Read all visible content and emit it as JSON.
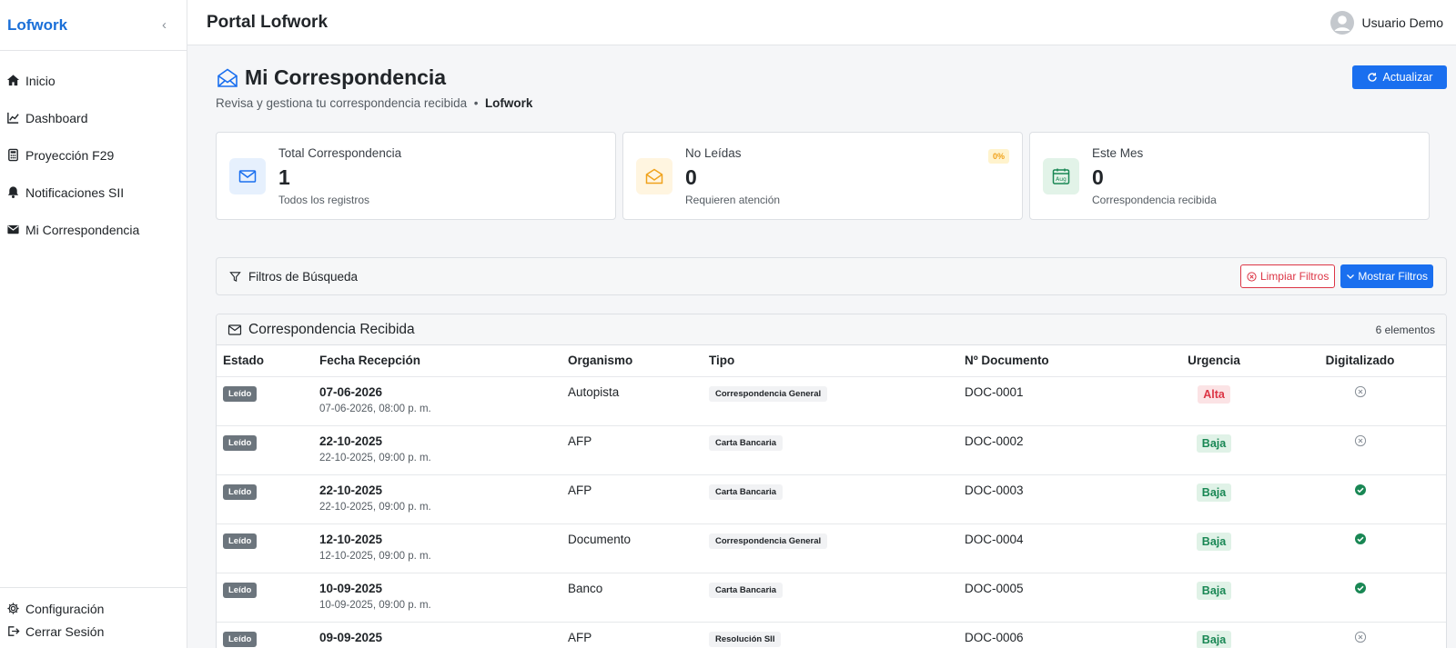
{
  "sidebar": {
    "brand": "Lofwork",
    "items": [
      {
        "label": "Inicio",
        "icon": "home-icon"
      },
      {
        "label": "Dashboard",
        "icon": "chart-line-icon"
      },
      {
        "label": "Proyección F29",
        "icon": "calculator-icon"
      },
      {
        "label": "Notificaciones SII",
        "icon": "bell-icon"
      },
      {
        "label": "Mi Correspondencia",
        "icon": "envelope-icon"
      }
    ],
    "bottom": [
      {
        "label": "Configuración",
        "icon": "gear-icon"
      },
      {
        "label": "Cerrar Sesión",
        "icon": "logout-icon"
      }
    ]
  },
  "topbar": {
    "title": "Portal Lofwork",
    "user": "Usuario Demo"
  },
  "page": {
    "title": "Mi Correspondencia",
    "subtitle": "Revisa y gestiona tu correspondencia recibida",
    "separator": "•",
    "company": "Lofwork",
    "refresh_label": "Actualizar"
  },
  "stats": [
    {
      "label": "Total Correspondencia",
      "value": "1",
      "note": "Todos los registros"
    },
    {
      "label": "No Leídas",
      "value": "0",
      "note": "Requieren atención",
      "badge": "0%"
    },
    {
      "label": "Este Mes",
      "value": "0",
      "note": "Correspondencia recibida",
      "icon_text": "Aug"
    }
  ],
  "filters": {
    "title": "Filtros de Búsqueda",
    "clear_label": "Limpiar Filtros",
    "show_label": "Mostrar Filtros"
  },
  "table": {
    "title": "Correspondencia Recibida",
    "count": "6 elementos",
    "columns": [
      "Estado",
      "Fecha Recepción",
      "Organismo",
      "Tipo",
      "Nº Documento",
      "Urgencia",
      "Digitalizado"
    ],
    "rows": [
      {
        "estado": "Leído",
        "fecha": "07-06-2026",
        "fecha_hora": "07-06-2026, 08:00 p. m.",
        "organismo": "Autopista",
        "tipo": "Correspondencia General",
        "documento": "DOC-0001",
        "urgencia": "Alta",
        "digitalizado": false
      },
      {
        "estado": "Leído",
        "fecha": "22-10-2025",
        "fecha_hora": "22-10-2025, 09:00 p. m.",
        "organismo": "AFP",
        "tipo": "Carta Bancaria",
        "documento": "DOC-0002",
        "urgencia": "Baja",
        "digitalizado": false
      },
      {
        "estado": "Leído",
        "fecha": "22-10-2025",
        "fecha_hora": "22-10-2025, 09:00 p. m.",
        "organismo": "AFP",
        "tipo": "Carta Bancaria",
        "documento": "DOC-0003",
        "urgencia": "Baja",
        "digitalizado": true
      },
      {
        "estado": "Leído",
        "fecha": "12-10-2025",
        "fecha_hora": "12-10-2025, 09:00 p. m.",
        "organismo": "Documento",
        "tipo": "Correspondencia General",
        "documento": "DOC-0004",
        "urgencia": "Baja",
        "digitalizado": true
      },
      {
        "estado": "Leído",
        "fecha": "10-09-2025",
        "fecha_hora": "10-09-2025, 09:00 p. m.",
        "organismo": "Banco",
        "tipo": "Carta Bancaria",
        "documento": "DOC-0005",
        "urgencia": "Baja",
        "digitalizado": true
      },
      {
        "estado": "Leído",
        "fecha": "09-09-2025",
        "fecha_hora": "",
        "organismo": "AFP",
        "tipo": "Resolución SII",
        "documento": "DOC-0006",
        "urgencia": "Baja",
        "digitalizado": false
      }
    ]
  },
  "colors": {
    "brand": "#1a6fd8",
    "primary": "#1a6fef",
    "danger": "#dc3545",
    "success": "#198754",
    "warning": "#f0a21c"
  }
}
